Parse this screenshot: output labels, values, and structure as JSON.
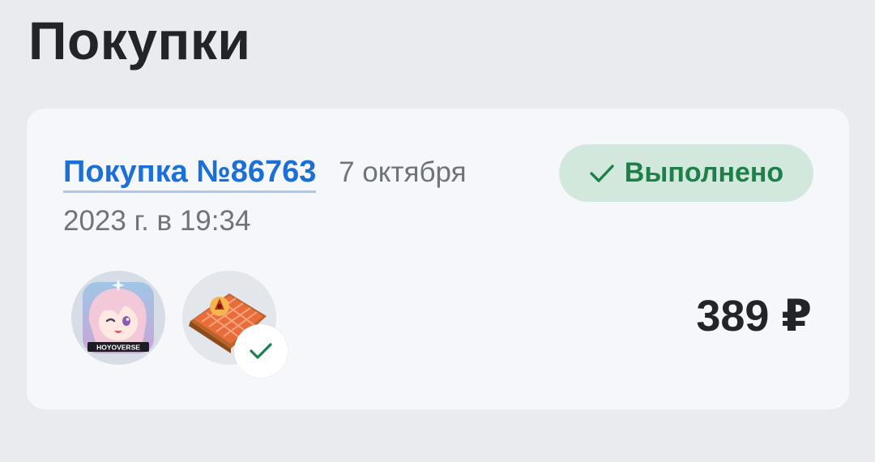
{
  "page": {
    "title": "Покупки"
  },
  "order": {
    "link_label": "Покупка №86763",
    "date": "7 октября 2023 г. в 19:34",
    "status_label": "Выполнено",
    "price": "389 ₽",
    "items": [
      {
        "name": "app-icon",
        "logo_text": "HOYOVERSE"
      },
      {
        "name": "gift-package-icon"
      }
    ]
  },
  "colors": {
    "link": "#1c6fd6",
    "status_text": "#1e8049",
    "status_bg": "#d2e8dd",
    "card_bg": "#f5f7fa",
    "page_bg": "#e9ebee"
  }
}
